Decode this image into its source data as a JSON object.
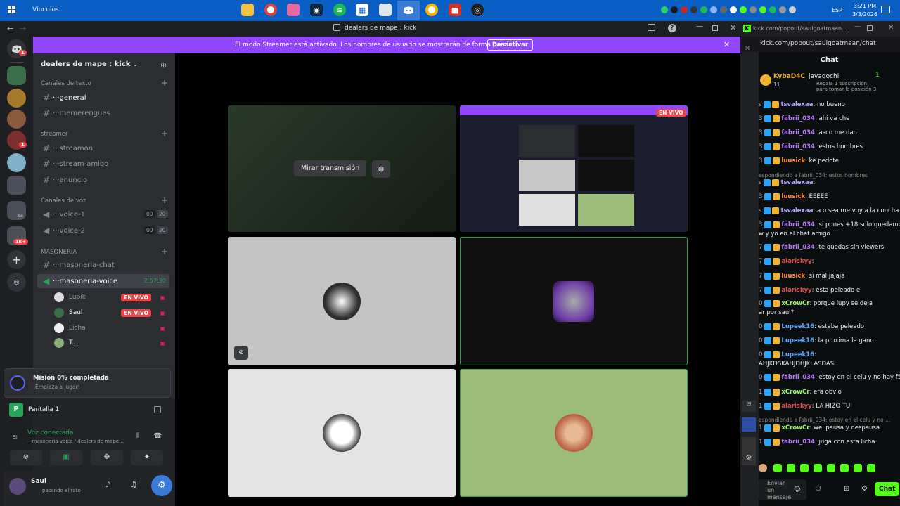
{
  "taskbar": {
    "label": "Vínculos",
    "lang": "ESP",
    "time": "3:21 PM",
    "date": "3/3/2026",
    "icons": [
      "file-explorer-icon",
      "chrome-icon",
      "app-icon",
      "steam-icon",
      "spotify-icon",
      "calendar-icon",
      "app-icon",
      "discord-icon",
      "chrome-icon",
      "app-icon",
      "obs-icon"
    ]
  },
  "discord": {
    "window_title": "dealers de mape : kick",
    "banner": {
      "text": "El modo Streamer está activado. Los nombres de usuario se mostrarán de forma parcial.",
      "button": "Desactivar"
    },
    "guild_badges": {
      "g1": "1",
      "g5": "1",
      "g9": "bs",
      "g10": "1K+"
    },
    "server_name": "dealers de mape : kick",
    "categories": {
      "text": "Canales de texto",
      "streamer": "streamer",
      "voice": "Canales de voz",
      "masoneria": "MASONERIA"
    },
    "channels": {
      "general": "···general",
      "memerengues": "···memerengues",
      "streamon": "···streamon",
      "stream_amigo": "···stream-amigo",
      "anuncio": "···anuncio",
      "voice1": "···voice-1",
      "voice1_a": "00",
      "voice1_b": "20",
      "voice2": "···voice-2",
      "voice2_a": "00",
      "voice2_b": "20",
      "masoneria_chat": "···masoneria-chat",
      "masoneria_voice": "···masoneria-voice",
      "masoneria_voice_time": "2:57:30"
    },
    "voice_users": [
      {
        "name": "Lupik",
        "live": "EN VIVO"
      },
      {
        "name": "Saul",
        "live": "EN VIVO"
      },
      {
        "name": "Licha",
        "live": ""
      },
      {
        "name": "T...",
        "live": ""
      }
    ],
    "mission": {
      "title": "Misión 0% completada",
      "subtitle": "¡Empieza a jugar!"
    },
    "screen": "Pantalla 1",
    "voice": {
      "status": "Voz conectada",
      "channel": "···masoneria-voice / dealers de mape..."
    },
    "user": {
      "name": "Saul",
      "status": "pasando el rato"
    },
    "stage": {
      "watch_button": "Mirar transmisión",
      "live_tag": "EN VIVO"
    }
  },
  "chat": {
    "window_url": "kick.com/popout/saulgoatmaan...",
    "url": "kick.com/popout/saulgoatmaan/chat",
    "title": "Chat",
    "pinned": {
      "user1": "KybaD4C",
      "n1": "11",
      "user2": "javagochi",
      "n2": "1",
      "text1": "Regala 1 suscripción",
      "text2": "para tomar la posición 3"
    },
    "messages": [
      {
        "p": "s",
        "u": "tsvalexaa",
        "c": "#b9a6ff",
        "t": ": no bueno"
      },
      {
        "p": "3",
        "u": "fabrii_034",
        "c": "#b97bff",
        "t": ": ahi va che"
      },
      {
        "p": "3",
        "u": "fabrii_034",
        "c": "#b97bff",
        "t": ": asco me dan"
      },
      {
        "p": "3",
        "u": "fabrii_034",
        "c": "#b97bff",
        "t": ": estos hombres"
      },
      {
        "p": "3",
        "u": "luusick",
        "c": "#ff8a3d",
        "t": ": ke pedote"
      },
      {
        "p": "",
        "u": "",
        "c": "#888",
        "t": "espondiendo a fabrii_034: estos hombres",
        "reply": true
      },
      {
        "p": "s",
        "u": "tsvalexaa",
        "c": "#b9a6ff",
        "t": ":"
      },
      {
        "p": "3",
        "u": "luusick",
        "c": "#ff8a3d",
        "t": ": EEEEE"
      },
      {
        "p": "s",
        "u": "tsvalexaa",
        "c": "#b9a6ff",
        "t": ": a o sea me voy a la concha"
      },
      {
        "p": "3",
        "u": "fabrii_034",
        "c": "#b97bff",
        "t": ": si pones +18 solo quedamos"
      },
      {
        "p": "",
        "u": "",
        "c": "#efeff1",
        "t": "w y yo en el chat amigo"
      },
      {
        "p": "7",
        "u": "fabrii_034",
        "c": "#b97bff",
        "t": ": te quedas sin viewers"
      },
      {
        "p": "7",
        "u": "alariskyy",
        "c": "#e84a4a",
        "t": ":"
      },
      {
        "p": "7",
        "u": "luusick",
        "c": "#ff8a3d",
        "t": ": si mal jajaja"
      },
      {
        "p": "7",
        "u": "alariskyy",
        "c": "#e84a4a",
        "t": ": esta peleado e"
      },
      {
        "p": "0",
        "u": "xCrowCr",
        "c": "#9eff6a",
        "t": ": porque lupy se deja"
      },
      {
        "p": "",
        "u": "",
        "c": "#efeff1",
        "t": "ar por saul?"
      },
      {
        "p": "0",
        "u": "Lupeek16",
        "c": "#5aa8ff",
        "t": ": estaba peleado"
      },
      {
        "p": "0",
        "u": "Lupeek16",
        "c": "#5aa8ff",
        "t": ": la proxima le gano"
      },
      {
        "p": "0",
        "u": "Lupeek16",
        "c": "#5aa8ff",
        "t": ":"
      },
      {
        "p": "",
        "u": "",
        "c": "#efeff1",
        "t": "AHJKDSKAHJDHJKLASDAS"
      },
      {
        "p": "0",
        "u": "fabrii_034",
        "c": "#b97bff",
        "t": ": estoy en el celu y no hay f5"
      },
      {
        "p": "1",
        "u": "xCrowCr",
        "c": "#9eff6a",
        "t": ":           era obvio"
      },
      {
        "p": "1",
        "u": "alariskyy",
        "c": "#e84a4a",
        "t": ": LA HIZO TU"
      },
      {
        "p": "",
        "u": "",
        "c": "#888",
        "t": "espondiendo a fabrii_034: estoy en el celu y no ...",
        "reply": true
      },
      {
        "p": "1",
        "u": "xCrowCr",
        "c": "#9eff6a",
        "t": ": wei pausa y despausa"
      },
      {
        "p": "1",
        "u": "fabrii_034",
        "c": "#b97bff",
        "t": ": juga con esta licha"
      }
    ],
    "input_placeholder": "Enviar un mensaje",
    "send_button": "Chat"
  }
}
